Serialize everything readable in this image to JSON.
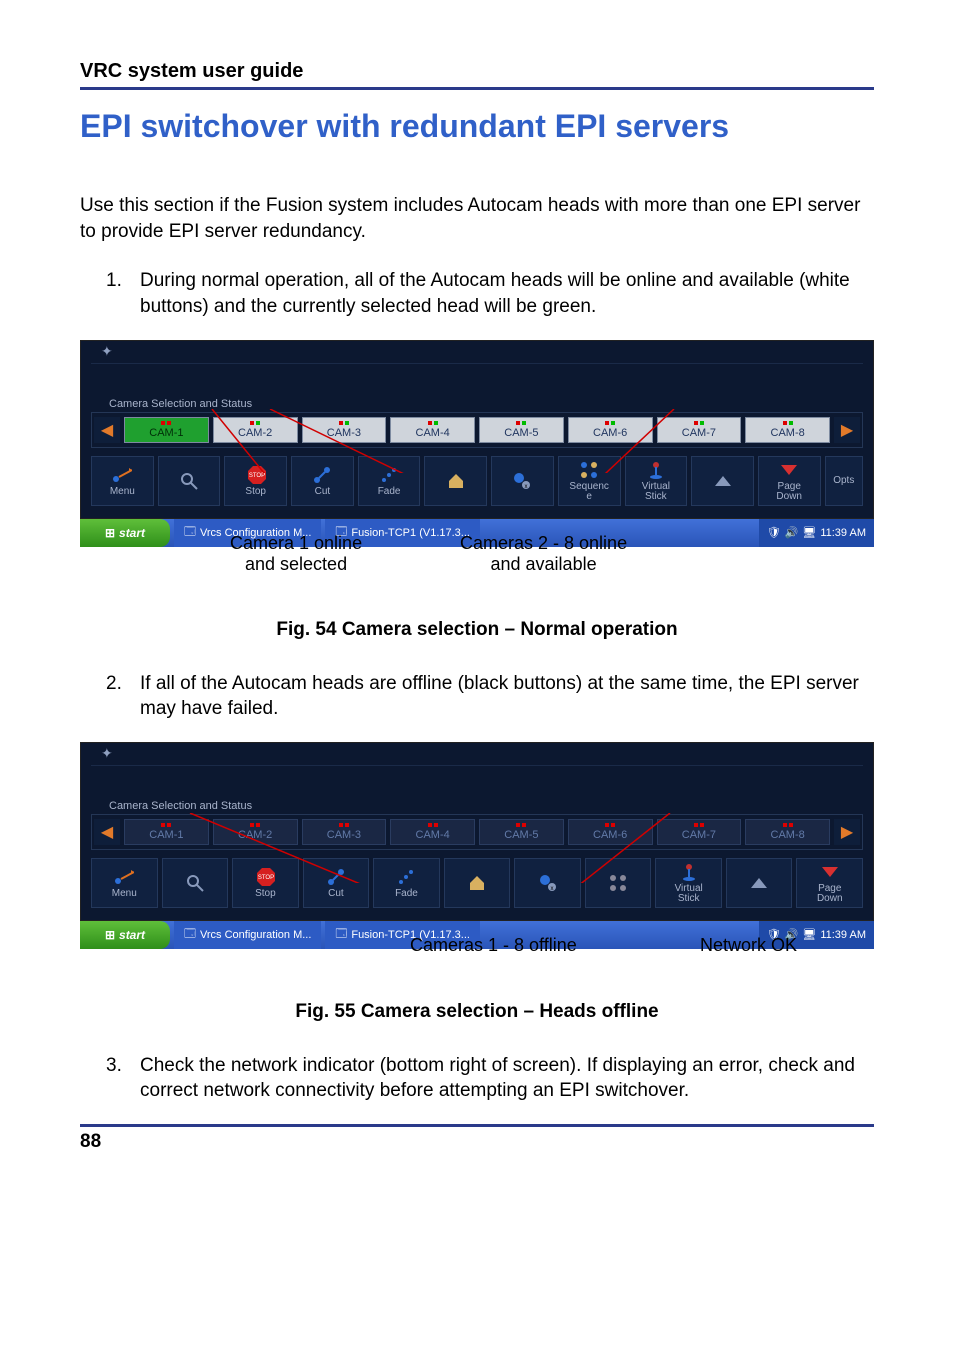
{
  "header": {
    "title": "VRC system user guide"
  },
  "page": {
    "title": "EPI switchover with redundant EPI servers",
    "intro": "Use this section if the Fusion system includes Autocam heads with more than one EPI server to provide EPI server redundancy.",
    "items": [
      {
        "num": "1.",
        "text": "During normal operation, all of the Autocam heads will be online and available (white buttons) and the currently selected head will be green."
      },
      {
        "num": "2.",
        "text": "If all of the Autocam heads are offline (black buttons) at the same time, the EPI server may have failed."
      },
      {
        "num": "3.",
        "text": "Check the network indicator (bottom right of screen). If displaying an error, check and correct network connectivity before attempting an EPI switchover."
      }
    ],
    "number": "88"
  },
  "figures": {
    "fig54": {
      "caption": "Fig. 54  Camera selection – Normal operation",
      "anno1": "Camera 1 online\nand selected",
      "anno2": "Cameras 2 - 8 online\nand available"
    },
    "fig55": {
      "caption": "Fig. 55  Camera selection – Heads offline",
      "anno1": "Cameras 1 - 8 offline",
      "anno2": "Network OK"
    }
  },
  "app": {
    "sectionLabel": "Camera Selection and Status",
    "cams": [
      "CAM-1",
      "CAM-2",
      "CAM-3",
      "CAM-4",
      "CAM-5",
      "CAM-6",
      "CAM-7",
      "CAM-8"
    ],
    "toolbar": {
      "menu": "Menu",
      "stop": "Stop",
      "cut": "Cut",
      "fade": "Fade",
      "sequence": "Sequenc\ne",
      "virtual": "Virtual\nStick",
      "pagedown": "Page\nDown",
      "opts": "Opts"
    },
    "taskbar": {
      "start": "start",
      "task1": "Vrcs Configuration M...",
      "task2": "Fusion-TCP1 (V1.17.3...",
      "time": "11:39 AM"
    }
  }
}
